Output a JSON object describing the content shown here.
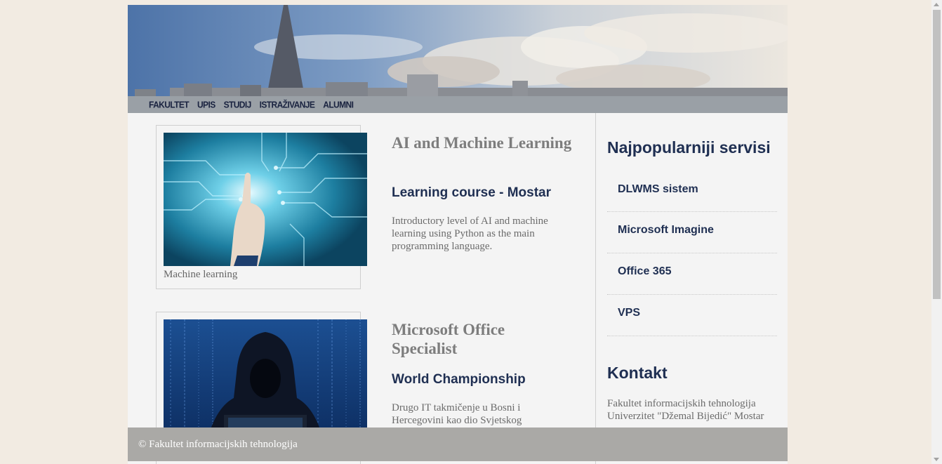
{
  "nav": {
    "items": [
      "FAKULTET",
      "UPIS",
      "STUDIJ",
      "ISTRAŽIVANJE",
      "ALUMNI"
    ]
  },
  "articles": [
    {
      "image_caption": "Machine learning",
      "title": "AI and Machine Learning",
      "subtitle": "Learning course - Mostar",
      "description": "Introductory level of AI and machine learning using Python as the main programming language."
    },
    {
      "image_caption": "",
      "title": "Microsoft Office Specialist",
      "subtitle": "World Championship",
      "description": "Drugo IT takmičenje u Bosni i Hercegovini kao dio Svjetskog"
    }
  ],
  "sidebar": {
    "title": "Najpopularniji servisi",
    "services": [
      "DLWMS sistem",
      "Microsoft Imagine",
      "Office 365",
      "VPS"
    ],
    "kontakt_title": "Kontakt",
    "kontakt_lines": [
      "Fakultet informacijskih tehnologija",
      "Univerzitet \"Džemal Bijedić\" Mostar"
    ]
  },
  "footer": {
    "text": "© Fakultet informacijskih tehnologija"
  },
  "colors": {
    "background": "#f2ebe2",
    "nav_bar": "#9aa0a6",
    "heading_navy": "#1f2f52",
    "footer": "#aaa9a6"
  }
}
